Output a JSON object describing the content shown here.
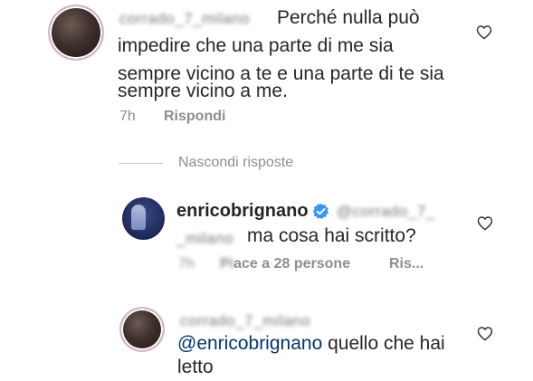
{
  "comment1": {
    "username_blurred": "corrado_7_milano",
    "text_lines": [
      "Perché nulla può",
      "impedire che una parte di me sia",
      "sempre vicino a te e una parte di te sia",
      "sempre vicino a me."
    ],
    "time": "7h",
    "reply_label": "Rispondi"
  },
  "replies_toggle": {
    "label": "Nascondi risposte"
  },
  "reply1": {
    "username": "enricobrignano",
    "verified": true,
    "mention_blurred_1": "@corrado_7_",
    "mention_blurred_2": "_milano",
    "text": "ma cosa hai scritto?",
    "time_blurred": "7h",
    "likes_prefix_blurred": "Pi",
    "likes_text": "ace a 28 persone",
    "reply_partial": "Ris..."
  },
  "reply2": {
    "username_blurred": "corrado_7_milano",
    "mention": "@enricobrignano",
    "text_rest": " quello che hai",
    "text_line2": "letto"
  },
  "colors": {
    "text": "#262626",
    "muted": "#8e8e8e",
    "mention": "#00376b",
    "verified": "#3897f0"
  },
  "icons": [
    "heart-icon",
    "verified-badge-icon"
  ]
}
